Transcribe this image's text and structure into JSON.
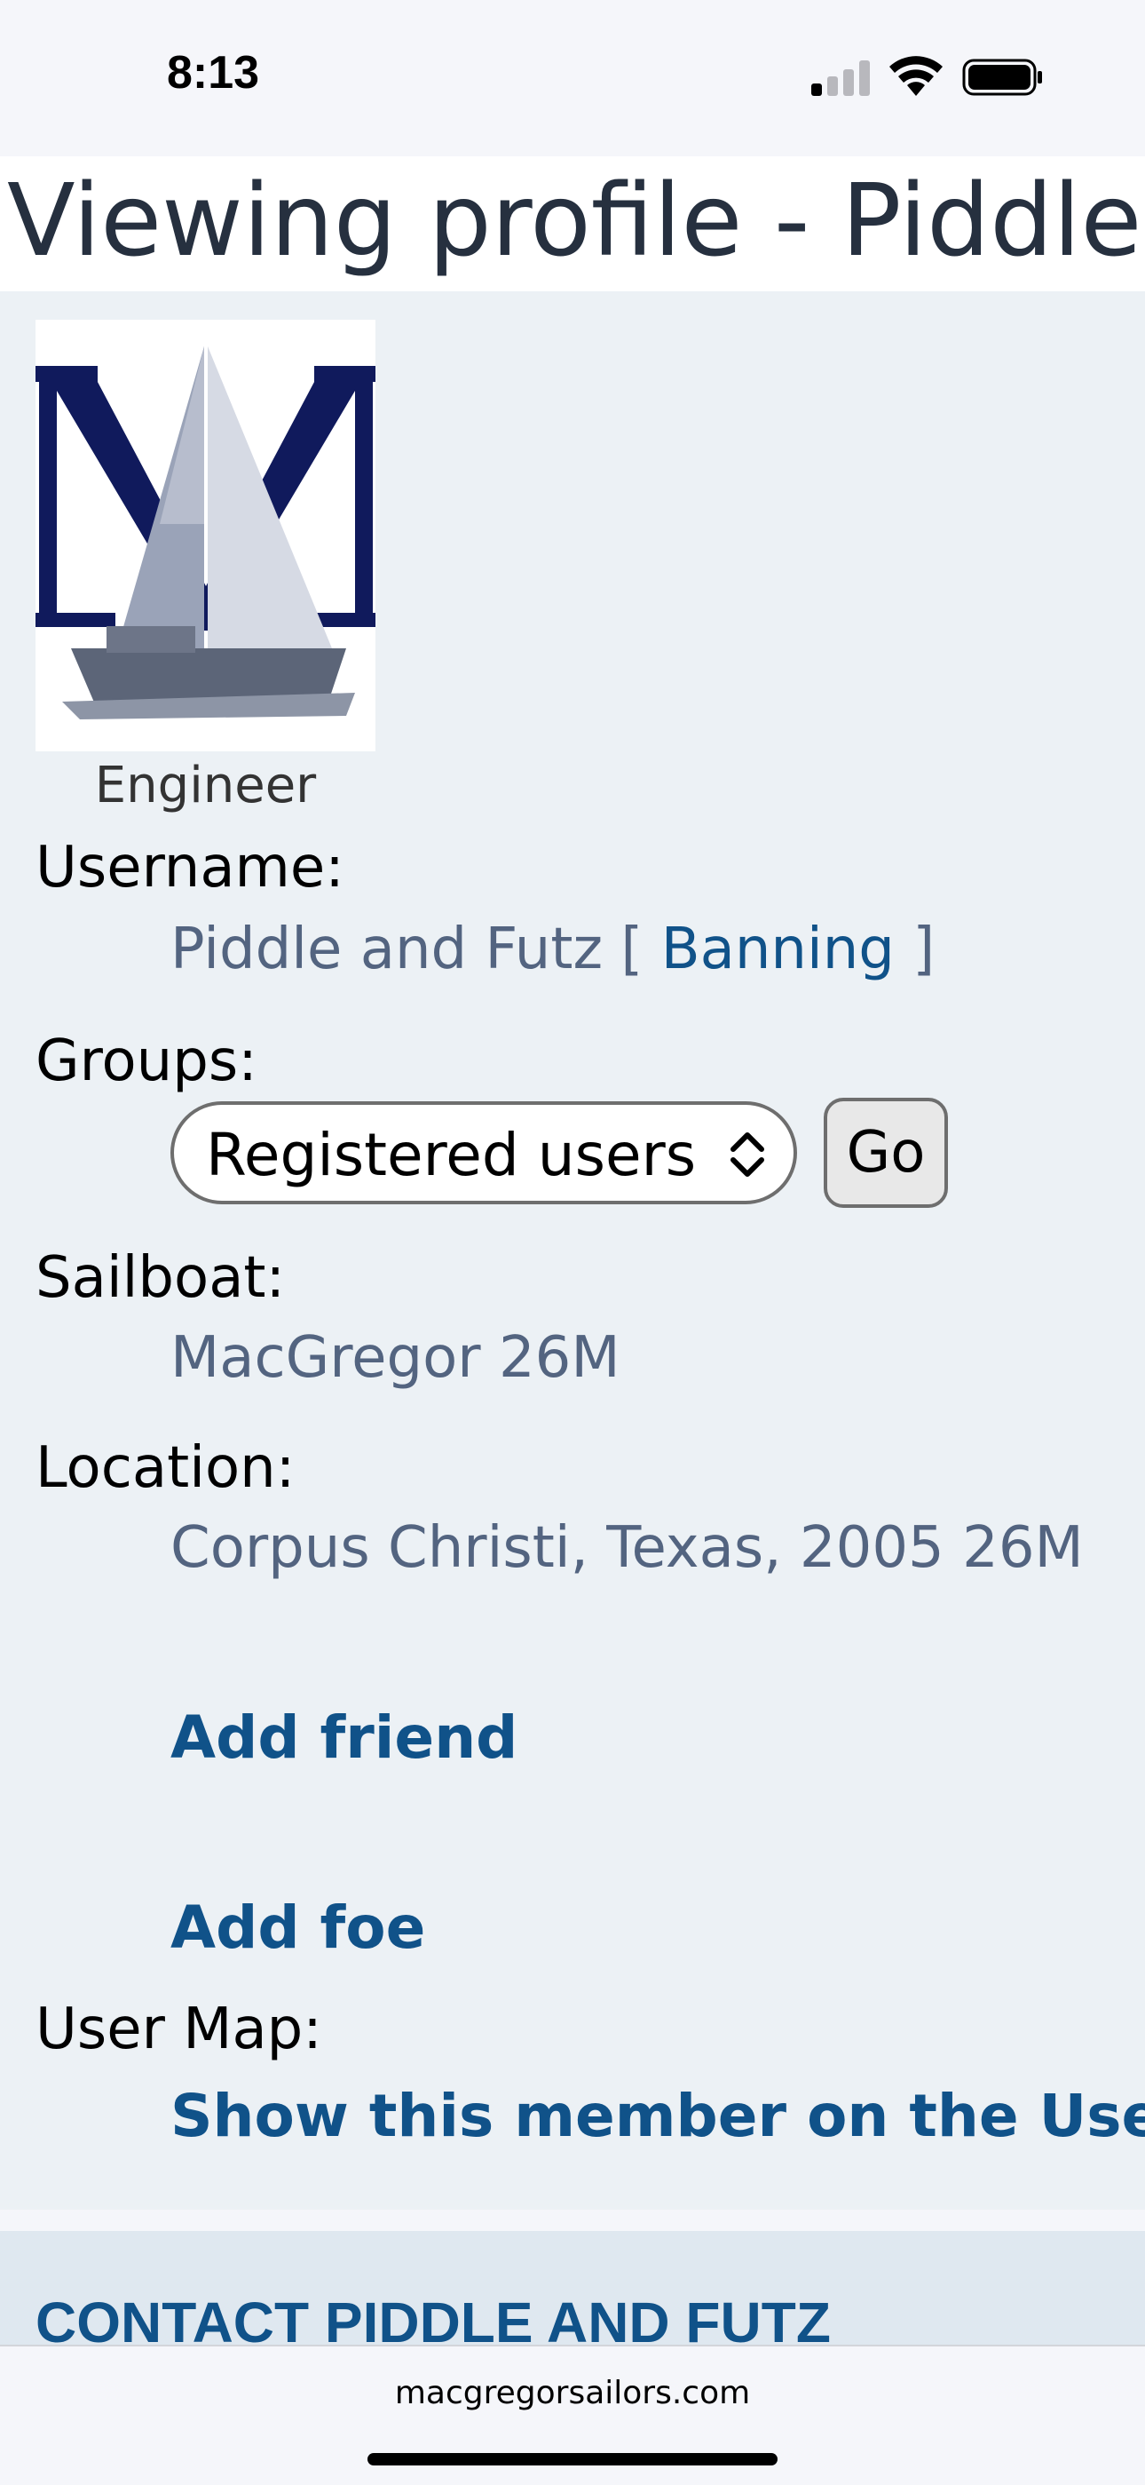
{
  "status_bar": {
    "time": "8:13"
  },
  "page": {
    "title": "Viewing profile - Piddle and Futz"
  },
  "profile": {
    "rank": "Engineer",
    "username_label": "Username:",
    "username": "Piddle and Futz",
    "bracket_open": "[",
    "ban_link": "Banning",
    "bracket_close": "]",
    "groups_label": "Groups:",
    "groups_selected": "Registered users",
    "go_label": "Go",
    "sailboat_label": "Sailboat:",
    "sailboat": "MacGregor 26M",
    "location_label": "Location:",
    "location": "Corpus Christi, Texas, 2005 26M",
    "add_friend": "Add friend",
    "add_foe": "Add foe",
    "usermap_label": "User Map:",
    "usermap_link": "Show this member on the User Map"
  },
  "contact": {
    "title": "CONTACT PIDDLE AND FUTZ"
  },
  "browser": {
    "url": "macgregorsailors.com"
  },
  "colors": {
    "link": "#105289",
    "value": "#536480",
    "panel": "#ecf1f5"
  }
}
